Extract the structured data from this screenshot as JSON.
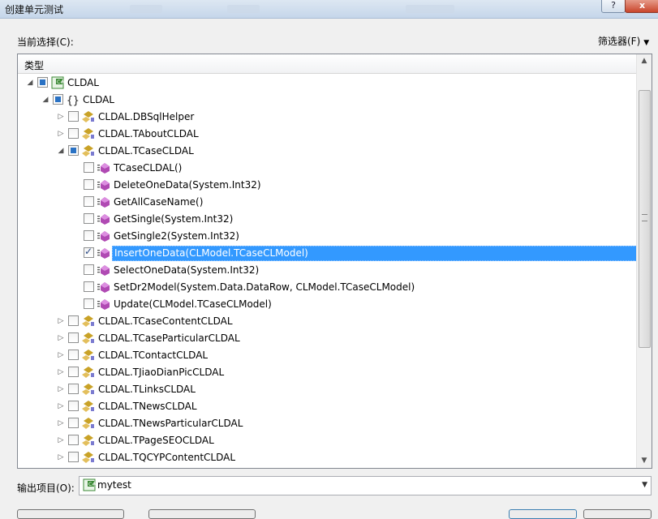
{
  "window": {
    "title": "创建单元测试",
    "help": "?",
    "close": "x"
  },
  "current_selection_label": "当前选择(C):",
  "filter_button": "筛选器(F)",
  "tree_header": "类型",
  "tree": [
    {
      "label": "CLDAL",
      "depth": 0,
      "expander": "expanded",
      "check": "partial",
      "icon": "csharp-project-icon"
    },
    {
      "label": "CLDAL",
      "depth": 1,
      "expander": "expanded",
      "check": "partial",
      "icon": "namespace-braces-icon"
    },
    {
      "label": "CLDAL.DBSqlHelper",
      "depth": 2,
      "expander": "collapsed",
      "check": "none",
      "icon": "class-icon"
    },
    {
      "label": "CLDAL.TAboutCLDAL",
      "depth": 2,
      "expander": "collapsed",
      "check": "none",
      "icon": "class-icon"
    },
    {
      "label": "CLDAL.TCaseCLDAL",
      "depth": 2,
      "expander": "expanded",
      "check": "partial",
      "icon": "class-icon"
    },
    {
      "label": "TCaseCLDAL()",
      "depth": 3,
      "expander": "none",
      "check": "none",
      "icon": "method-icon"
    },
    {
      "label": "DeleteOneData(System.Int32)",
      "depth": 3,
      "expander": "none",
      "check": "none",
      "icon": "method-icon"
    },
    {
      "label": "GetAllCaseName()",
      "depth": 3,
      "expander": "none",
      "check": "none",
      "icon": "method-icon"
    },
    {
      "label": "GetSingle(System.Int32)",
      "depth": 3,
      "expander": "none",
      "check": "none",
      "icon": "method-icon"
    },
    {
      "label": "GetSingle2(System.Int32)",
      "depth": 3,
      "expander": "none",
      "check": "none",
      "icon": "method-icon"
    },
    {
      "label": "InsertOneData(CLModel.TCaseCLModel)",
      "depth": 3,
      "expander": "none",
      "check": "checked",
      "icon": "method-icon",
      "selected": true
    },
    {
      "label": "SelectOneData(System.Int32)",
      "depth": 3,
      "expander": "none",
      "check": "none",
      "icon": "method-icon"
    },
    {
      "label": "SetDr2Model(System.Data.DataRow, CLModel.TCaseCLModel)",
      "depth": 3,
      "expander": "none",
      "check": "none",
      "icon": "method-icon"
    },
    {
      "label": "Update(CLModel.TCaseCLModel)",
      "depth": 3,
      "expander": "none",
      "check": "none",
      "icon": "method-icon"
    },
    {
      "label": "CLDAL.TCaseContentCLDAL",
      "depth": 2,
      "expander": "collapsed",
      "check": "none",
      "icon": "class-icon"
    },
    {
      "label": "CLDAL.TCaseParticularCLDAL",
      "depth": 2,
      "expander": "collapsed",
      "check": "none",
      "icon": "class-icon"
    },
    {
      "label": "CLDAL.TContactCLDAL",
      "depth": 2,
      "expander": "collapsed",
      "check": "none",
      "icon": "class-icon"
    },
    {
      "label": "CLDAL.TJiaoDianPicCLDAL",
      "depth": 2,
      "expander": "collapsed",
      "check": "none",
      "icon": "class-icon"
    },
    {
      "label": "CLDAL.TLinksCLDAL",
      "depth": 2,
      "expander": "collapsed",
      "check": "none",
      "icon": "class-icon"
    },
    {
      "label": "CLDAL.TNewsCLDAL",
      "depth": 2,
      "expander": "collapsed",
      "check": "none",
      "icon": "class-icon"
    },
    {
      "label": "CLDAL.TNewsParticularCLDAL",
      "depth": 2,
      "expander": "collapsed",
      "check": "none",
      "icon": "class-icon"
    },
    {
      "label": "CLDAL.TPageSEOCLDAL",
      "depth": 2,
      "expander": "collapsed",
      "check": "none",
      "icon": "class-icon"
    },
    {
      "label": "CLDAL.TQCYPContentCLDAL",
      "depth": 2,
      "expander": "collapsed",
      "check": "none",
      "icon": "class-icon"
    }
  ],
  "output_project_label": "输出项目(O):",
  "output_project_value": "mytest",
  "colors": {
    "selection": "#3399ff",
    "method": "#b04ab3",
    "class": "#c9a227",
    "accent": "#2a72c4"
  }
}
